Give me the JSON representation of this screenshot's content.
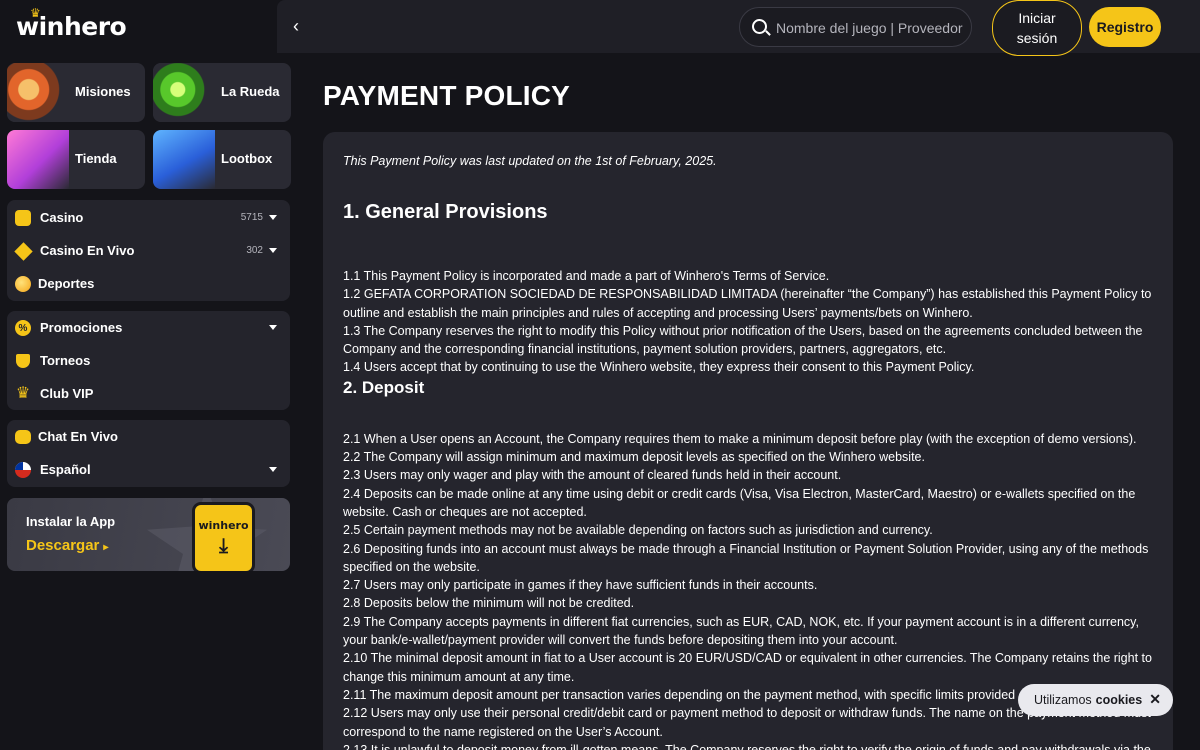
{
  "brand": {
    "logo": "winhero"
  },
  "tiles": [
    {
      "label": "Misiones"
    },
    {
      "label": "La Rueda"
    },
    {
      "label": "Tienda"
    },
    {
      "label": "Lootbox"
    }
  ],
  "nav": {
    "casino": {
      "label": "Casino",
      "count": "5715"
    },
    "live": {
      "label": "Casino En Vivo",
      "count": "302"
    },
    "sports": {
      "label": "Deportes"
    },
    "promos": {
      "label": "Promociones"
    },
    "tournaments": {
      "label": "Torneos"
    },
    "vip": {
      "label": "Club VIP"
    },
    "chat": {
      "label": "Chat En Vivo"
    },
    "language": {
      "label": "Español"
    }
  },
  "app": {
    "title": "Instalar la App",
    "download": "Descargar",
    "phone_brand": "winhero"
  },
  "header": {
    "search_placeholder": "Nombre del juego | Proveedor",
    "login_label": "Iniciar sesión",
    "register_label": "Registro"
  },
  "page": {
    "title": "PAYMENT POLICY",
    "updated": "This Payment Policy was last updated on the 1st of February, 2025.",
    "section1_title": "1. General Provisions",
    "section1_items": [
      "1.1 This Payment Policy is incorporated and made a part of Winhero's Terms of Service.",
      "1.2 GEFATA CORPORATION SOCIEDAD DE RESPONSABILIDAD LIMITADA (hereinafter “the Company”) has established this Payment Policy to outline and establish the main principles and rules of accepting and processing Users’ payments/bets on Winhero.",
      "1.3 The Company reserves the right to modify this Policy without prior notification of the Users, based on the agreements concluded between the Company and the corresponding financial institutions, payment solution providers, partners, aggregators, etc.",
      "1.4 Users accept that by continuing to use the Winhero website, they express their consent to this Payment Policy."
    ],
    "section2_title": "2. Deposit",
    "section2_items": [
      "2.1 When a User opens an Account, the Company requires them to make a minimum deposit before play (with the exception of demo versions).",
      "2.2 The Company will assign minimum and maximum deposit levels as specified on the Winhero website.",
      "2.3 Users may only wager and play with the amount of cleared funds held in their account.",
      "2.4 Deposits can be made online at any time using debit or credit cards (Visa, Visa Electron, MasterCard, Maestro) or e-wallets specified on the website. Cash or cheques are not accepted.",
      "2.5 Certain payment methods may not be available depending on factors such as jurisdiction and currency.",
      "2.6 Depositing funds into an account must always be made through a Financial Institution or Payment Solution Provider, using any of the methods specified on the website.",
      "2.7 Users may only participate in games if they have sufficient funds in their accounts.",
      "2.8 Deposits below the minimum will not be credited.",
      "2.9 The Company accepts payments in different fiat currencies, such as EUR, CAD, NOK, etc. If your payment account is in a different currency, your bank/e-wallet/payment provider will convert the funds before depositing them into your account.",
      "2.10 The minimal deposit amount in fiat to a User account is 20 EUR/USD/CAD or equivalent in other currencies. The Company retains the right to change this minimum amount at any time.",
      "2.11 The maximum deposit amount per transaction varies depending on the payment method, with specific limits provided on",
      "2.12 Users may only use their personal credit/debit card or payment method to deposit or withdraw funds. The name on the payment method must correspond to the name registered on the User’s Account.",
      "2.13 It is unlawful to deposit money from ill-gotten means. The Company reserves the right to verify the origin of funds and pay withdrawals via the"
    ]
  },
  "cookie": {
    "text": "Utilizamos",
    "bold": "cookies",
    "close": "✕"
  },
  "colors": {
    "accent": "#f5c518",
    "background": "#141419",
    "panel": "#25252d"
  }
}
